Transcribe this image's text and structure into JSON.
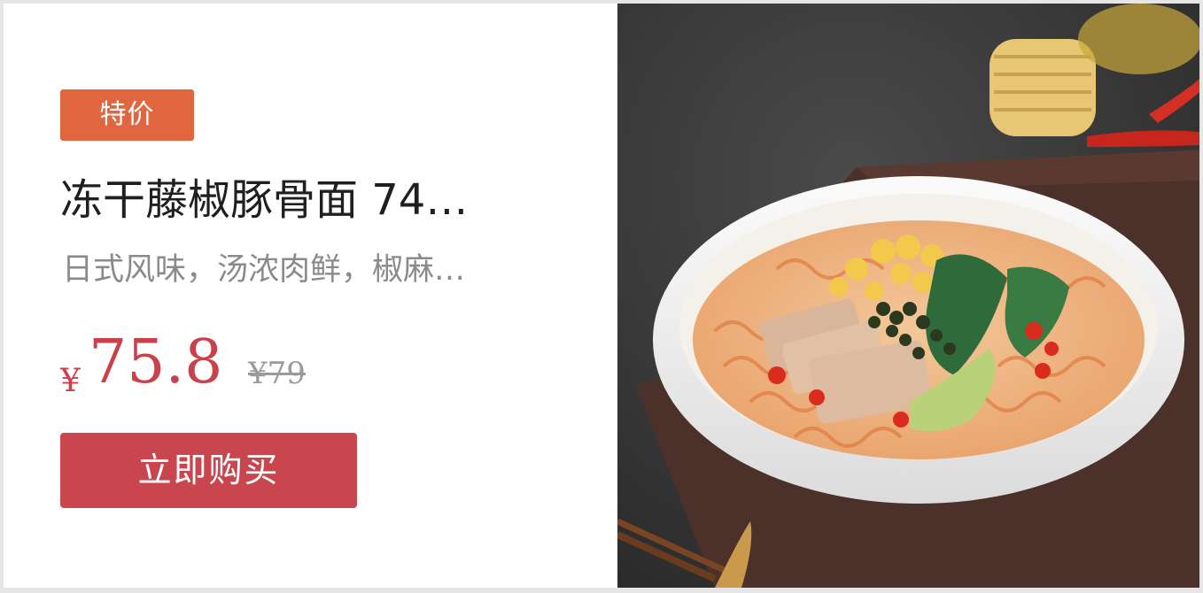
{
  "product": {
    "tag": "特价",
    "title": "冻干藤椒豚骨面 74…",
    "subtitle": "日式风味，汤浓肉鲜，椒麻…",
    "currency": "¥",
    "price": "75.8",
    "original_price": "¥79",
    "buy_label": "立即购买"
  },
  "image": {
    "subject": "noodle-bowl-photo"
  },
  "colors": {
    "tag_bg": "#e0663f",
    "price": "#c9414b",
    "button_bg": "#c9464f",
    "title": "#1f1f1f",
    "subtitle": "#8a8a8a"
  }
}
